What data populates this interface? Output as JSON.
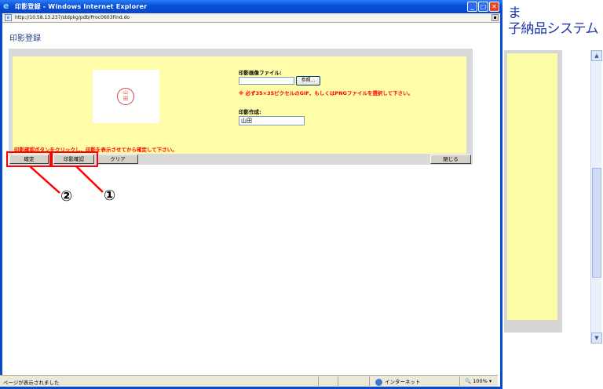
{
  "background_app": {
    "title_line1": "ま",
    "title_line2": "子納品システム"
  },
  "window": {
    "title": "印影登録 - Windows Internet Explorer",
    "address_url": "http://10.58.13.237/stdpkg/pdb/Proc0603Find.do",
    "minimize_glyph": "_",
    "maximize_glyph": "□",
    "close_glyph": "✕"
  },
  "page": {
    "heading": "印影登録"
  },
  "form": {
    "stamp_char_top": "山",
    "stamp_char_bottom": "田",
    "file_label": "印影画像ファイル:",
    "file_value": "",
    "browse_label": "参照...",
    "file_note": "※ 必ず35×35ピクセルのGIF、もしくはPNGファイルを選択して下さい。",
    "name_label": "印影作成:",
    "name_value": "山田",
    "instruction": "印影確認ボタンをクリックし、印影を表示させてから確定して下さい。"
  },
  "buttons": {
    "confirm": "確定",
    "preview": "印影確認",
    "clear": "クリア",
    "close": "閉じる"
  },
  "callouts": {
    "first": "①",
    "second": "②"
  },
  "statusbar": {
    "text": "ページが表示されました",
    "zone": "インターネット",
    "zoom": "100%"
  },
  "colors": {
    "highlight": "#ff0000",
    "panel_yellow": "#fffda9",
    "titlebar_blue": "#0650d6"
  }
}
